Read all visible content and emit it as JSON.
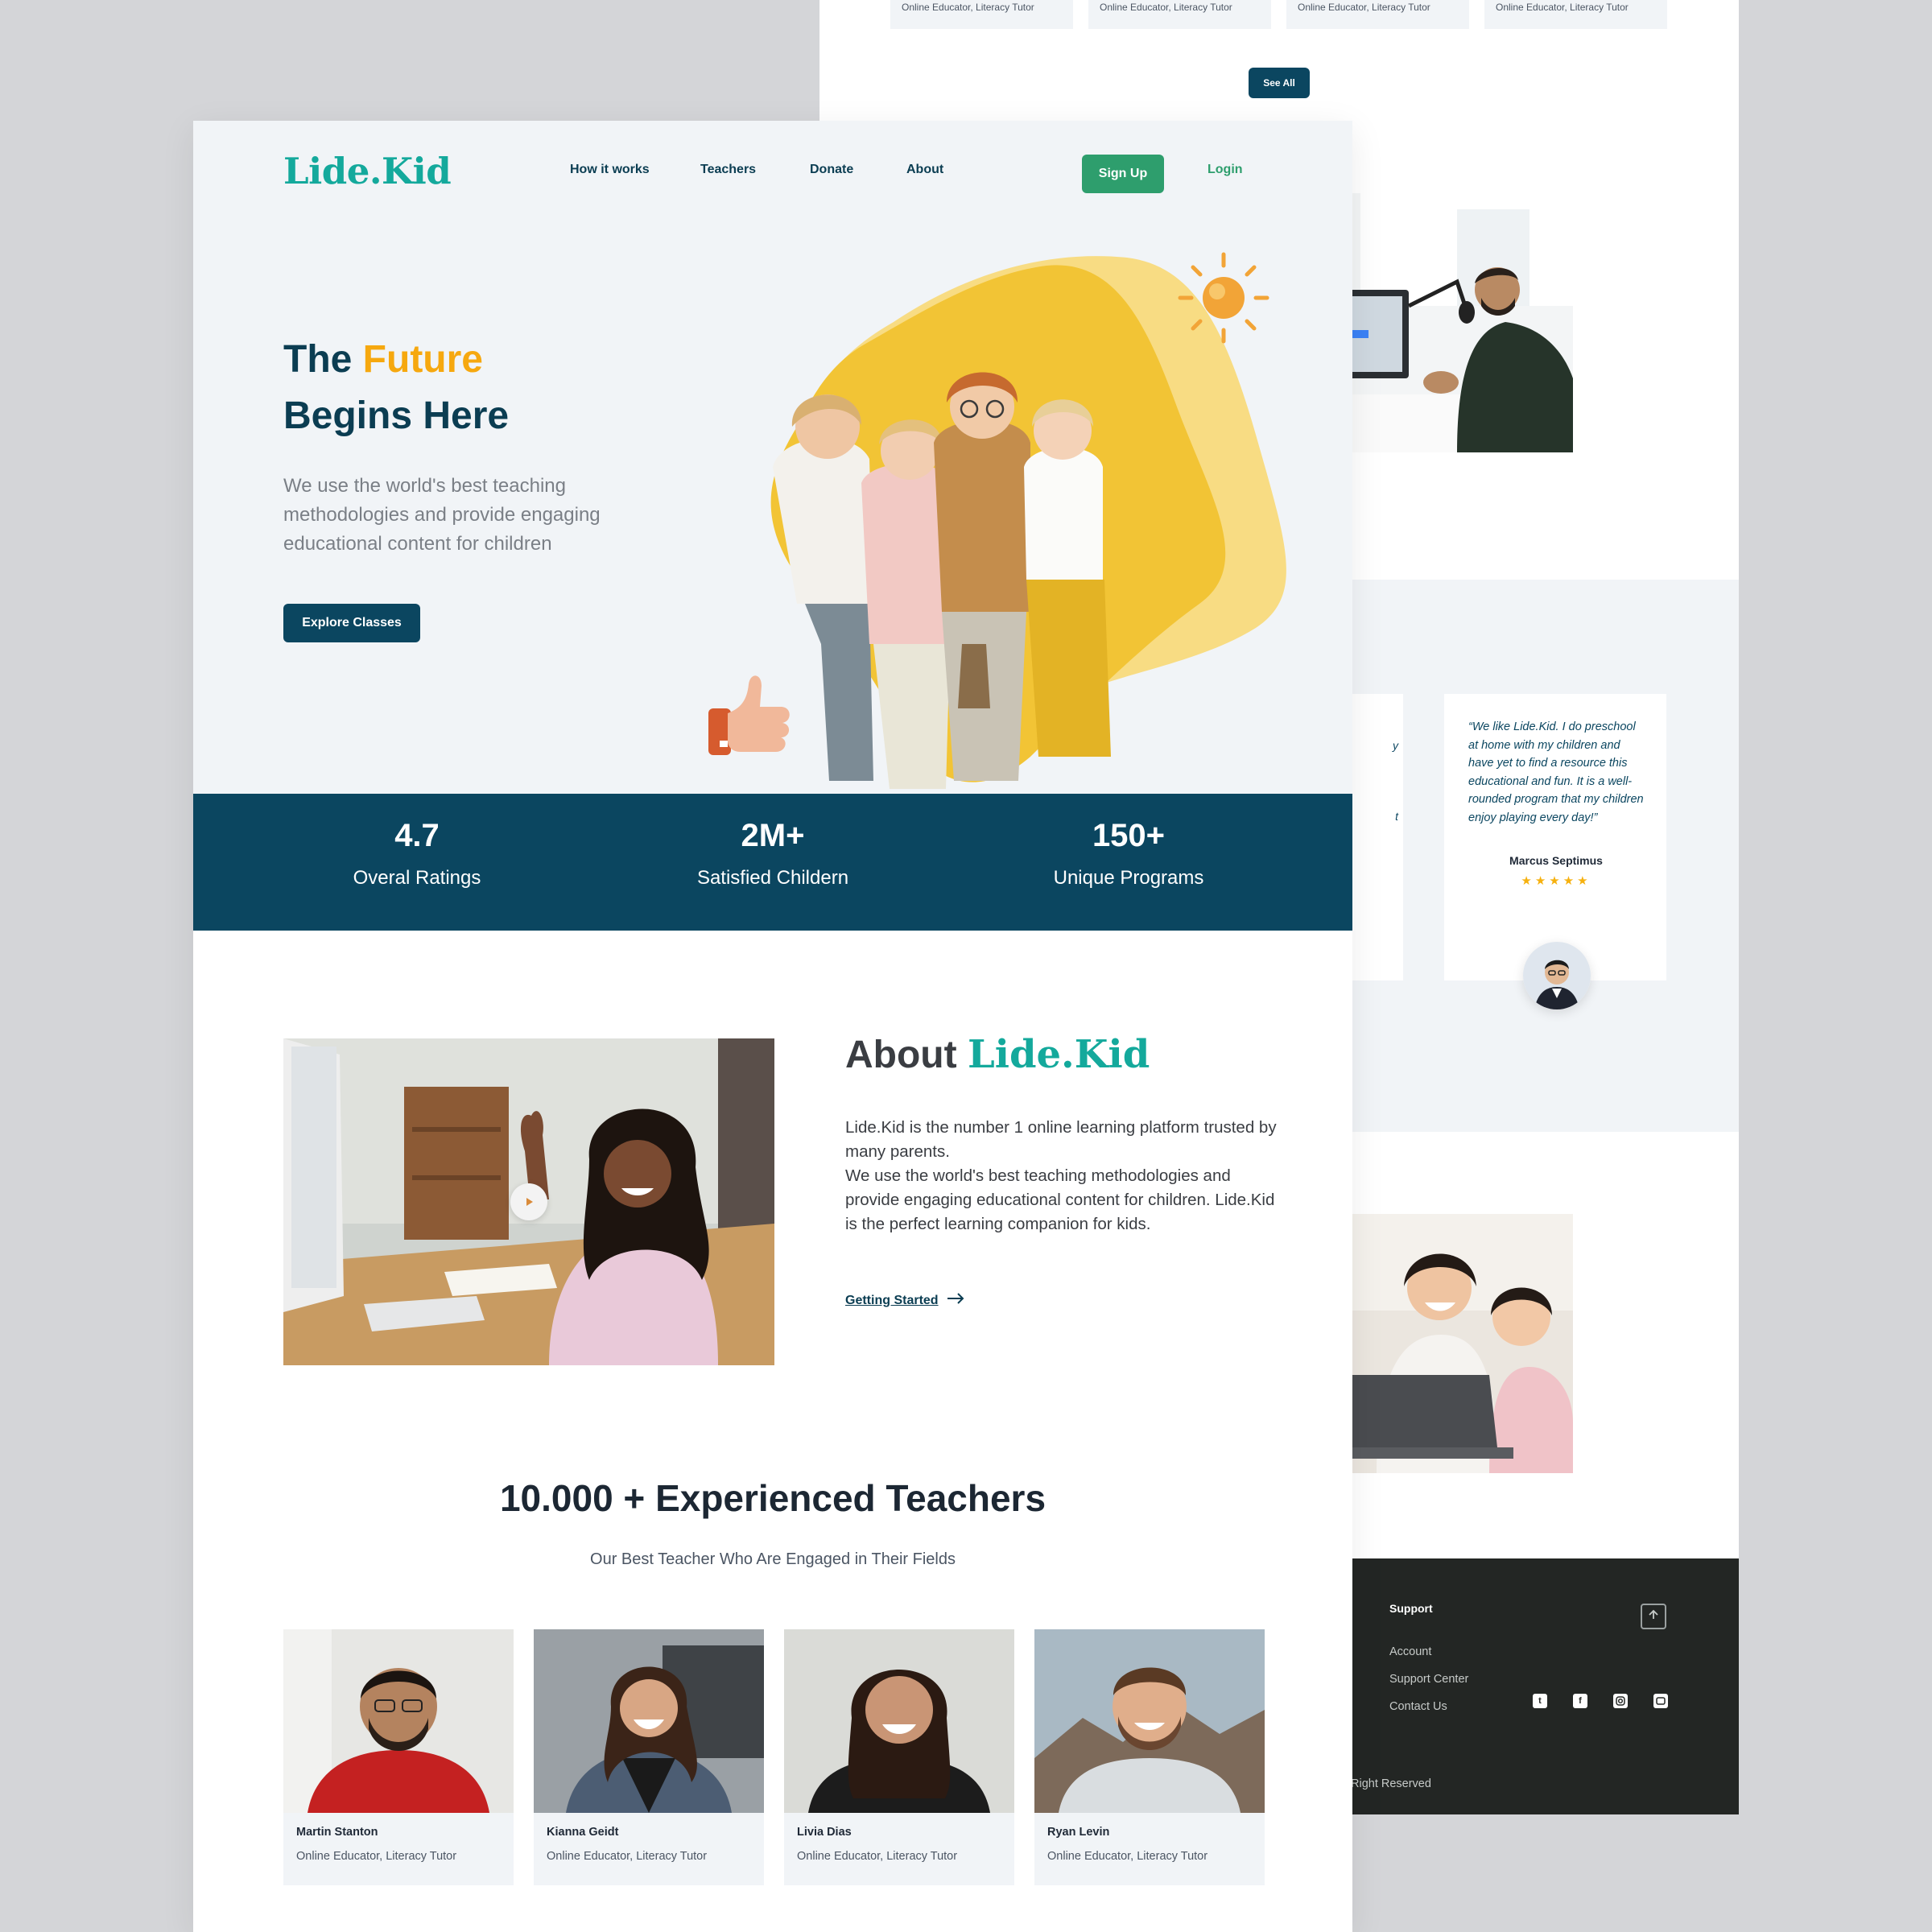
{
  "back_page": {
    "teacher_cards": [
      {
        "role": "Online Educator, Literacy Tutor"
      },
      {
        "role": "Online Educator, Literacy Tutor"
      },
      {
        "role": "Online Educator, Literacy Tutor"
      },
      {
        "role": "Online Educator, Literacy Tutor"
      }
    ],
    "see_all_label": "See All",
    "testimonial": {
      "partial_left_letters": [
        "y",
        "t"
      ],
      "quote": "“We like Lide.Kid. I do preschool at home with my children and have yet to find a resource this educational and fun. It is a well-rounded program that my children enjoy playing every day!”",
      "author": "Marcus Septimus",
      "stars": "★★★★★",
      "rating": 5
    },
    "footer": {
      "support_title": "Support",
      "links": [
        "Account",
        "Support Center",
        "Contact Us"
      ],
      "rights": "Right Reserved",
      "socials": [
        "twitter-icon",
        "facebook-icon",
        "instagram-icon",
        "youtube-icon"
      ],
      "background": "#232624"
    }
  },
  "header": {
    "logo": "Lide.Kid",
    "nav": [
      "How it works",
      "Teachers",
      "Donate",
      "About"
    ],
    "signup_label": "Sign Up",
    "login_label": "Login"
  },
  "hero": {
    "title_part1": "The ",
    "title_accent": "Future",
    "title_line2": "Begins Here",
    "subtitle": "We use the world's best teaching methodologies and provide engaging educational content for children",
    "cta_label": "Explore Classes"
  },
  "stats": [
    {
      "value": "4.7",
      "label": "Overal Ratings"
    },
    {
      "value": "2M+",
      "label": "Satisfied Childern"
    },
    {
      "value": "150+",
      "label": "Unique Programs"
    }
  ],
  "about": {
    "title_prefix": "About ",
    "title_brand": "Lide.Kid",
    "paragraph1": "Lide.Kid is the number 1 online learning platform trusted by many parents.",
    "paragraph2": "We use the world's best teaching methodologies and provide engaging educational content for children. Lide.Kid is the perfect learning companion for kids.",
    "link_label": "Getting Started"
  },
  "teachers": {
    "title": "10.000 + Experienced Teachers",
    "subtitle": "Our Best Teacher Who Are Engaged in Their Fields",
    "cards": [
      {
        "name": "Martin Stanton",
        "role": "Online Educator, Literacy Tutor"
      },
      {
        "name": "Kianna Geidt",
        "role": "Online Educator, Literacy Tutor"
      },
      {
        "name": "Livia Dias",
        "role": "Online Educator, Literacy Tutor"
      },
      {
        "name": "Ryan Levin",
        "role": "Online Educator, Literacy Tutor"
      }
    ]
  },
  "colors": {
    "brand_teal": "#14a99c",
    "navy": "#0b4660",
    "heading_navy": "#0b3d52",
    "accent_orange": "#f6a80f",
    "signup_green": "#2e9e6d",
    "light_bg": "#f1f4f7",
    "star_yellow": "#f6b10f"
  }
}
